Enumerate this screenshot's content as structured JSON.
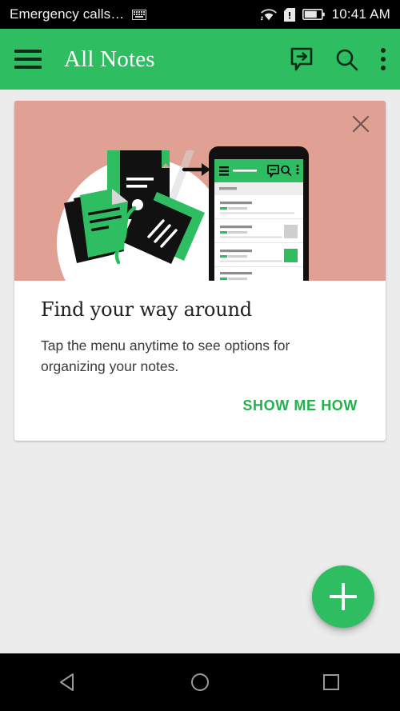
{
  "status_bar": {
    "carrier_text": "Emergency calls…",
    "keyboard_icon": "keyboard-icon",
    "wifi_icon": "wifi-icon",
    "sim_icon": "sim-card-alert-icon",
    "battery_icon": "battery-icon",
    "time": "10:41 AM"
  },
  "app_bar": {
    "menu_icon": "hamburger-menu-icon",
    "title": "All Notes",
    "actions": [
      {
        "name": "reminder-icon",
        "label": "Reminders"
      },
      {
        "name": "search-icon",
        "label": "Search"
      },
      {
        "name": "overflow-menu-icon",
        "label": "More options"
      }
    ]
  },
  "promo_card": {
    "close_icon": "close-icon",
    "title": "Find your way around",
    "description": "Tap the menu anytime to see options for organizing your notes.",
    "cta_label": "SHOW ME HOW",
    "illustration": {
      "name": "onboarding-illustration",
      "background_color": "#E0A093",
      "elements": [
        "notebook",
        "papers",
        "tag",
        "arrow",
        "phone-mockup"
      ]
    }
  },
  "fab": {
    "name": "add-note-fab",
    "icon": "plus-icon",
    "color": "#2EBD60"
  },
  "nav_bar": {
    "back_label": "Back",
    "home_label": "Home",
    "recents_label": "Recents"
  },
  "colors": {
    "accent_green": "#2EBD60",
    "cta_green": "#22B14C",
    "salmon": "#E0A093",
    "page_background": "#ECECEC",
    "status_bar": "#000000"
  }
}
